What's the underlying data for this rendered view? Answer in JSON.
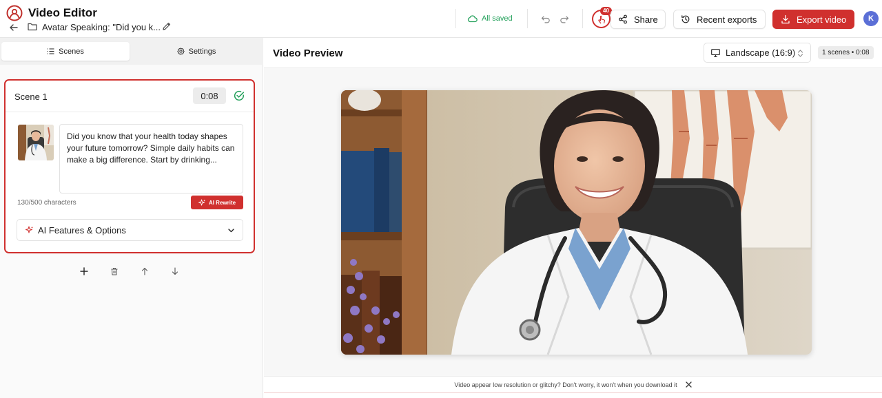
{
  "header": {
    "app_title": "Video Editor",
    "project_name": "Avatar Speaking: \"Did you k...",
    "save_status": "All saved",
    "notification_count": "40",
    "share_label": "Share",
    "recent_exports_label": "Recent exports",
    "export_label": "Export video",
    "user_initial": "K"
  },
  "left_panel": {
    "tabs": [
      {
        "label": "Scenes",
        "icon": "list-icon",
        "active": true
      },
      {
        "label": "Settings",
        "icon": "gear-icon",
        "active": false
      }
    ],
    "scene": {
      "title": "Scene 1",
      "duration": "0:08",
      "script": "Did you know that your health today shapes your future tomorrow? Simple daily habits can make a big difference. Start by drinking...",
      "char_count": "130/500 characters",
      "ai_rewrite_label": "AI Rewrite",
      "features_label": "AI Features & Options"
    },
    "actions": [
      "plus-icon",
      "trash-icon",
      "arrow-up-icon",
      "arrow-down-icon"
    ]
  },
  "preview": {
    "title": "Video Preview",
    "aspect_ratio": "Landscape (16:9)",
    "scene_summary": "1 scenes • 0:08",
    "notice": "Video appear low resolution or glitchy? Don't worry, it won't when you download it"
  },
  "colors": {
    "accent": "#d0302e",
    "success": "#22a05a",
    "avatar": "#5b6fd6"
  }
}
